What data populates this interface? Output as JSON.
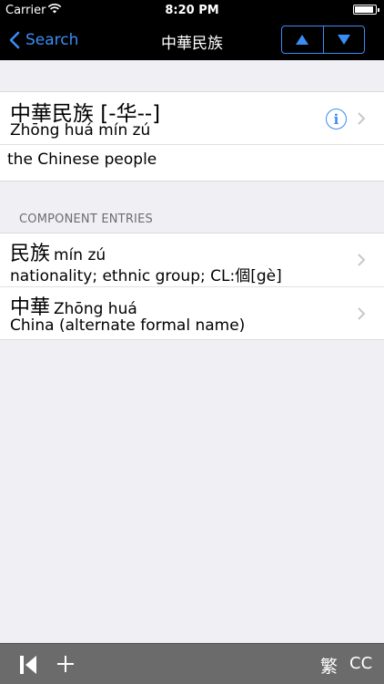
{
  "status_bar": {
    "carrier": "Carrier",
    "time": "8:20 PM",
    "wifi_icon": "wifi-icon",
    "battery_icon": "battery-icon"
  },
  "nav": {
    "back_label": "Search",
    "title": "中華民族",
    "up_icon": "arrow-up-icon",
    "down_icon": "arrow-down-icon"
  },
  "entry": {
    "headword": "中華民族 [-华--]",
    "pinyin": "Zhōng huá mín zú",
    "definition": "the Chinese people",
    "info_icon_glyph": "i"
  },
  "components": {
    "header": "COMPONENT ENTRIES",
    "items": [
      {
        "hanzi": "民族",
        "pinyin": "mín zú",
        "definition": "nationality; ethnic group; CL:個[gè]"
      },
      {
        "hanzi": "中華",
        "pinyin": "Zhōng huá",
        "definition": "China (alternate formal name)"
      }
    ]
  },
  "toolbar": {
    "first_icon": "skip-to-start-icon",
    "add_icon": "plus-icon",
    "traditional_label": "繁",
    "cc_label": "CC"
  },
  "colors": {
    "accent": "#3a8df5",
    "nav_background": "#000000",
    "page_background": "#efeff4",
    "toolbar_background": "#6b6b6b"
  }
}
